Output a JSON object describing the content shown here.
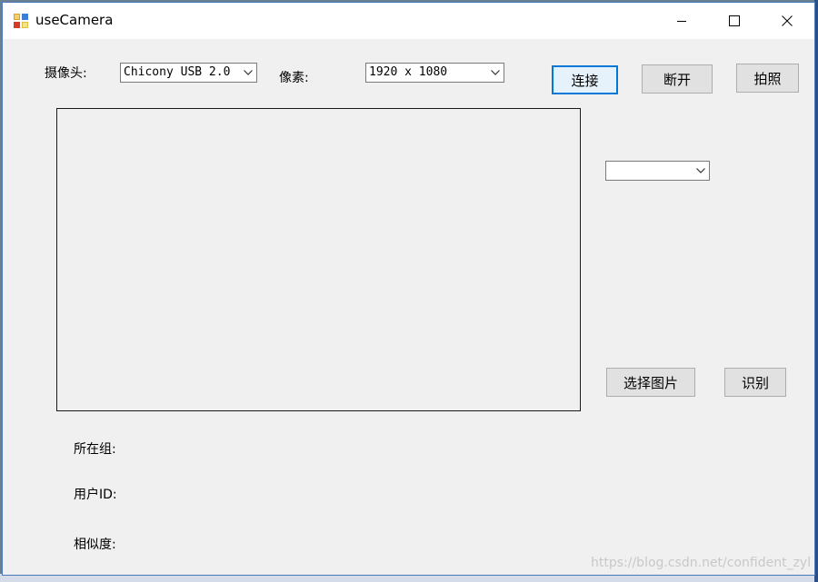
{
  "window": {
    "title": "useCamera",
    "minimize_icon": "minimize-icon",
    "maximize_icon": "maximize-icon",
    "close_icon": "close-icon"
  },
  "camera": {
    "label": "摄像头:",
    "selected": "Chicony USB 2.0 "
  },
  "resolution": {
    "label": "像素:",
    "selected": "1920 x 1080"
  },
  "buttons": {
    "connect": "连接",
    "disconnect": "断开",
    "capture": "拍照",
    "select_image": "选择图片",
    "recognize": "识别"
  },
  "group_select": {
    "selected": ""
  },
  "results": {
    "group_label": "所在组:",
    "user_id_label": "用户ID:",
    "similarity_label": "相似度:"
  },
  "watermark": "https://blog.csdn.net/confident_zyl",
  "colors": {
    "default_button_border": "#0078d7",
    "window_bg": "#f0f0f0"
  }
}
